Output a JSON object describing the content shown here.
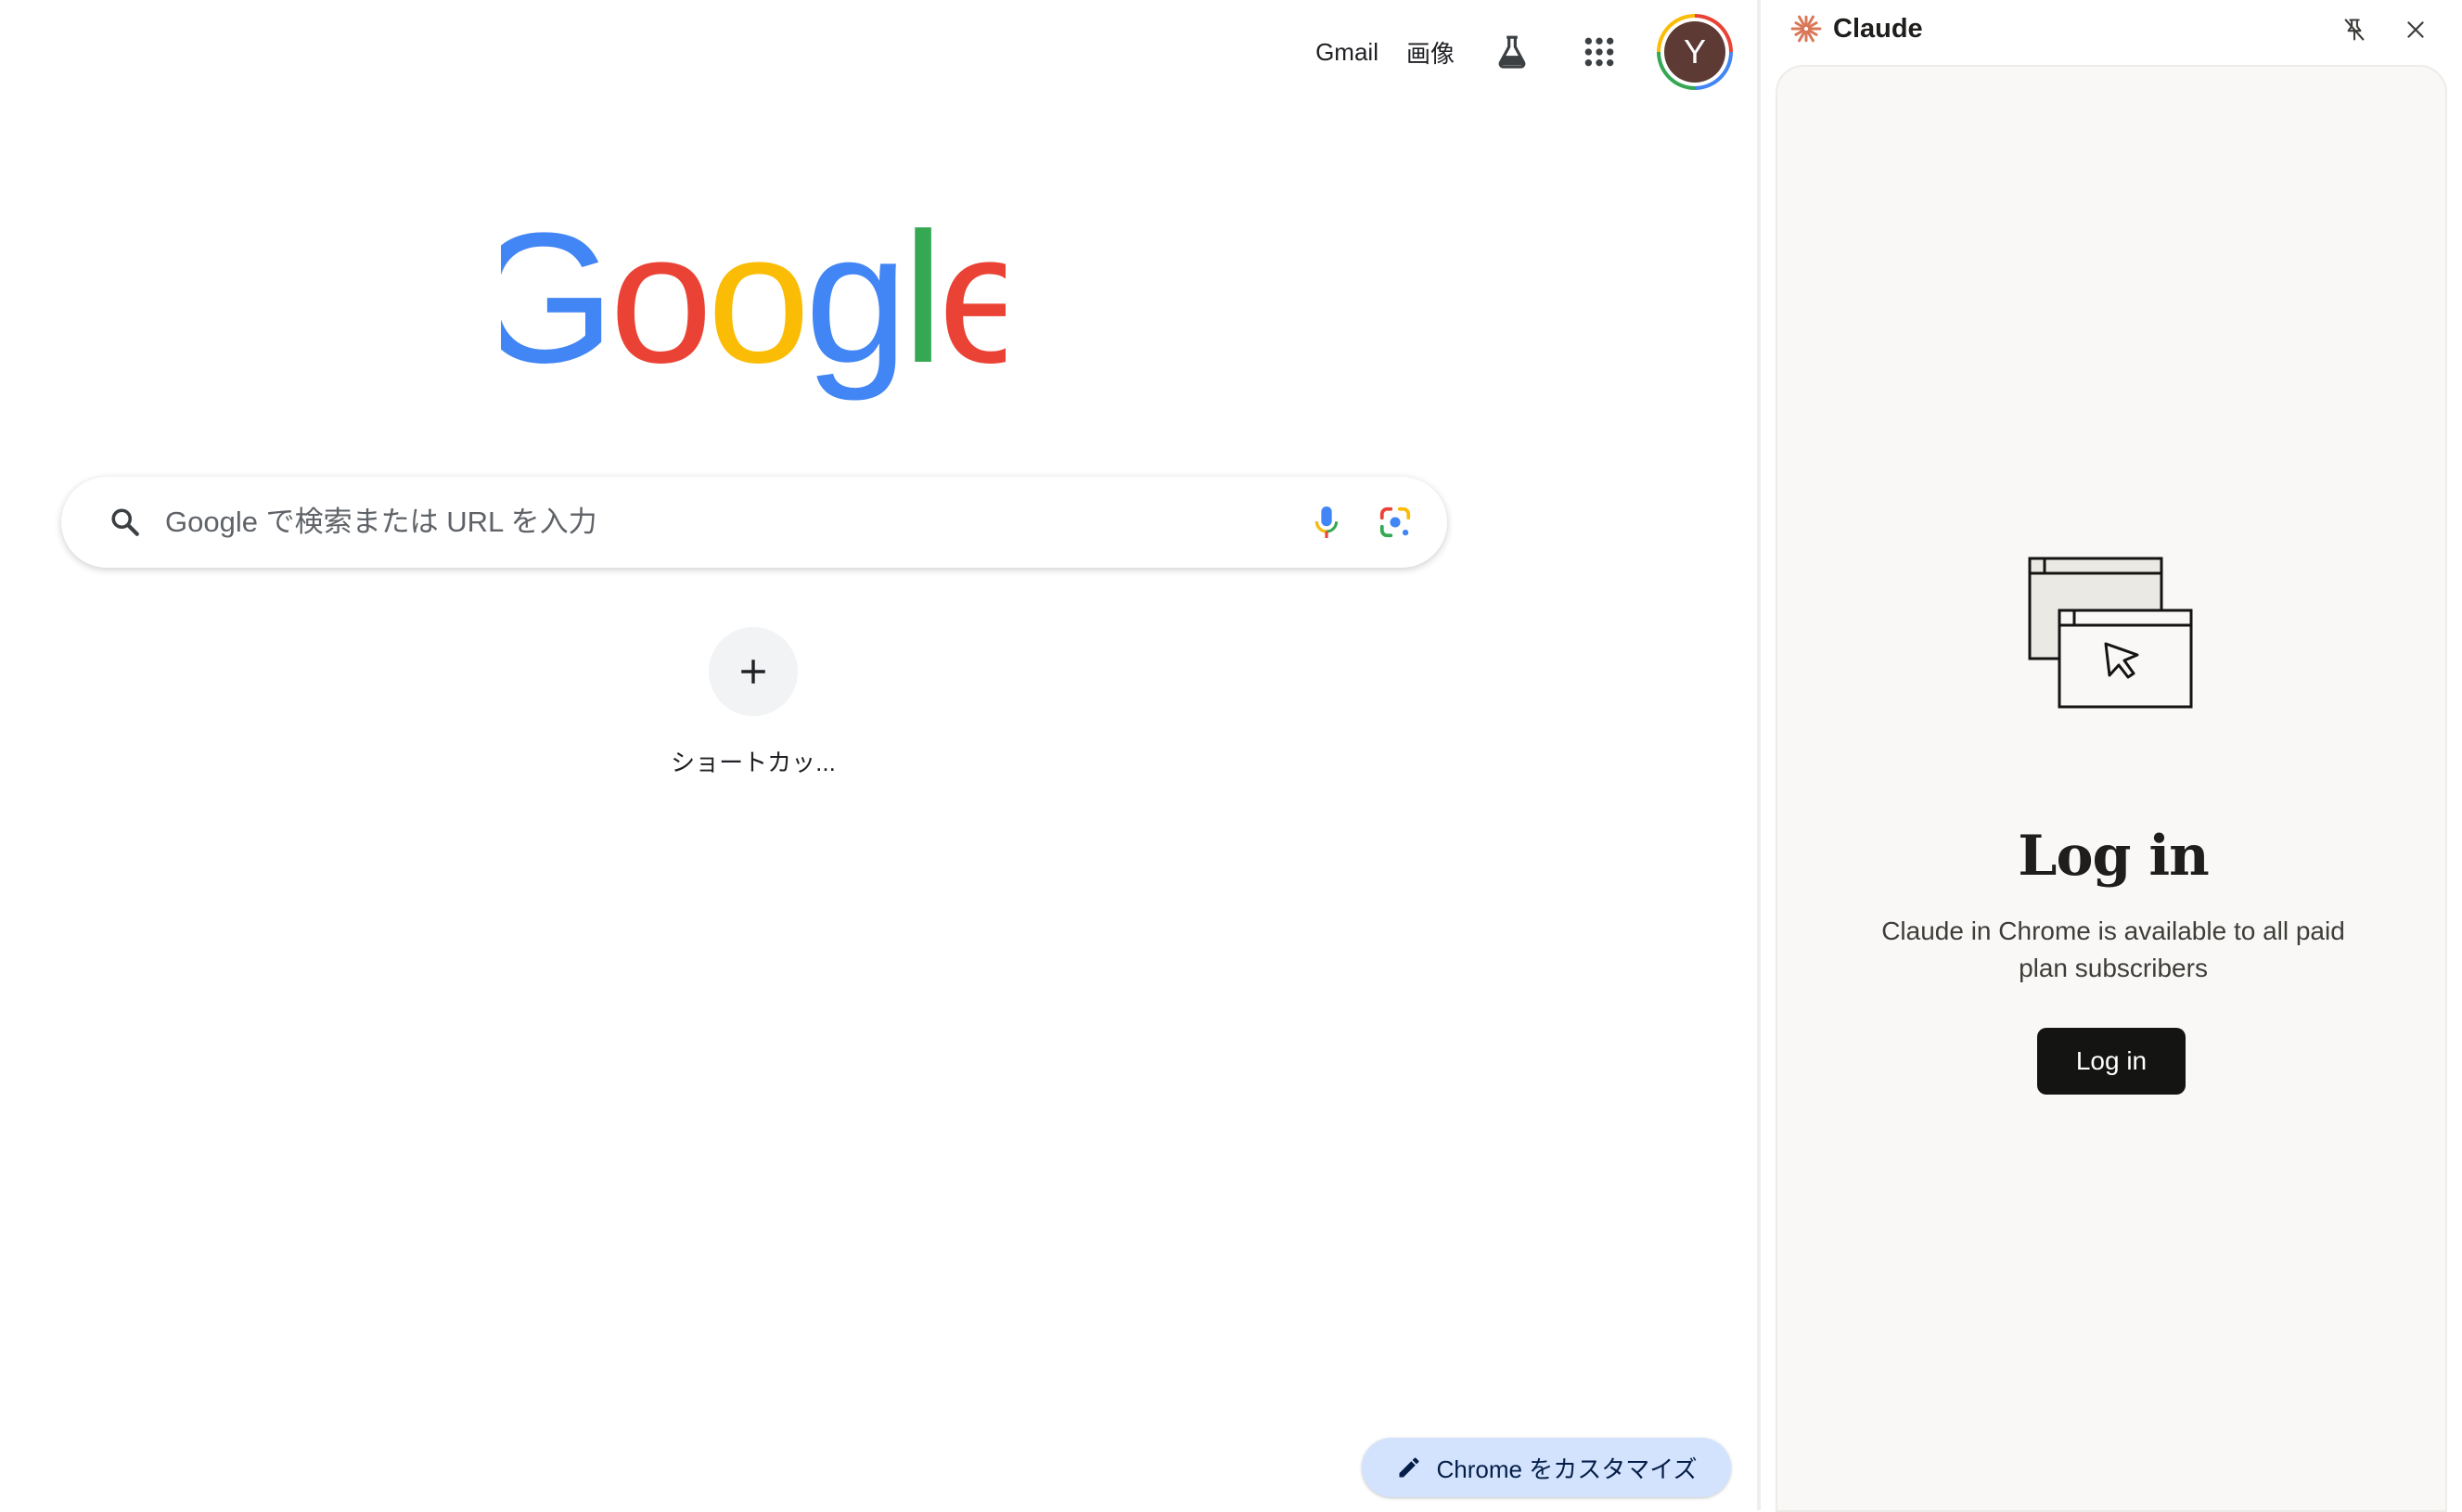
{
  "ntp": {
    "topbar": {
      "gmail_label": "Gmail",
      "images_label": "画像",
      "avatar_letter": "Y"
    },
    "logo": {
      "letters": [
        "G",
        "o",
        "o",
        "g",
        "l",
        "e"
      ],
      "colors": [
        "#4285f4",
        "#ea4335",
        "#fbbc05",
        "#4285f4",
        "#34a853",
        "#ea4335"
      ]
    },
    "search": {
      "placeholder": "Google で検索または URL を入力",
      "value": ""
    },
    "shortcut": {
      "add_label": "ショートカッ..."
    },
    "customize": {
      "label": "Chrome をカスタマイズ"
    }
  },
  "claude_panel": {
    "title": "Claude",
    "accent_color": "#d97757",
    "heading": "Log in",
    "description": "Claude in Chrome is available to all paid plan subscribers",
    "login_button_label": "Log in"
  }
}
